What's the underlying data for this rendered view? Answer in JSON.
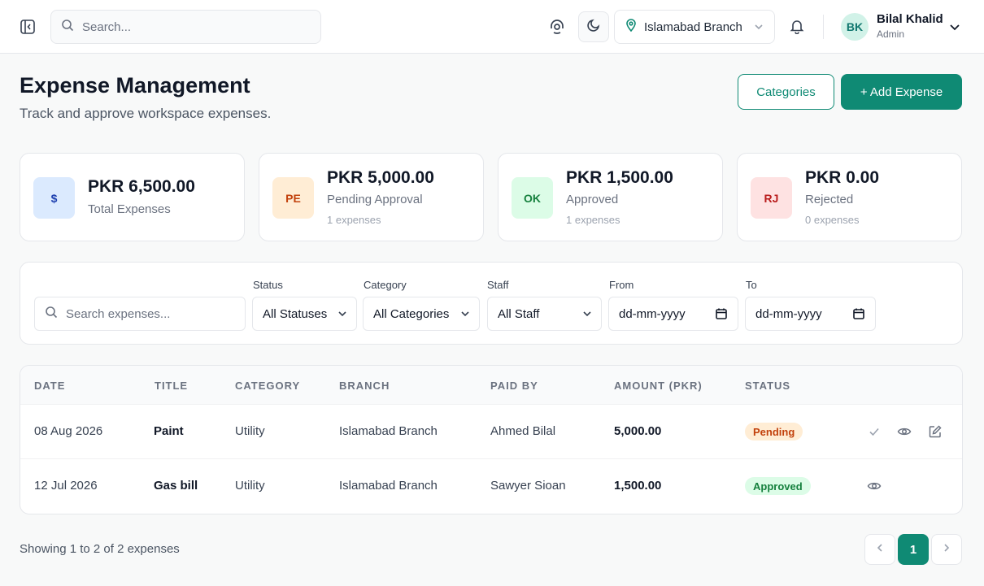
{
  "header": {
    "search_placeholder": "Search...",
    "branch": "Islamabad Branch",
    "user": {
      "initials": "BK",
      "name": "Bilal Khalid",
      "role": "Admin"
    }
  },
  "page": {
    "title": "Expense Management",
    "subtitle": "Track and approve workspace expenses.",
    "categories_label": "Categories",
    "add_label": "+ Add Expense"
  },
  "stats": [
    {
      "icon_text": "$",
      "amount": "PKR 6,500.00",
      "label": "Total Expenses",
      "count": "",
      "icon_bg": "#dbeafe",
      "icon_color": "#1e40af"
    },
    {
      "icon_text": "PE",
      "amount": "PKR 5,000.00",
      "label": "Pending Approval",
      "count": "1 expenses",
      "icon_bg": "#ffedd5",
      "icon_color": "#c2410c"
    },
    {
      "icon_text": "OK",
      "amount": "PKR 1,500.00",
      "label": "Approved",
      "count": "1 expenses",
      "icon_bg": "#dcfce7",
      "icon_color": "#15803d"
    },
    {
      "icon_text": "RJ",
      "amount": "PKR 0.00",
      "label": "Rejected",
      "count": "0 expenses",
      "icon_bg": "#fee2e2",
      "icon_color": "#b91c1c"
    }
  ],
  "filters": {
    "search_placeholder": "Search expenses...",
    "status_label": "Status",
    "status_value": "All Statuses",
    "category_label": "Category",
    "category_value": "All Categories",
    "staff_label": "Staff",
    "staff_value": "All Staff",
    "from_label": "From",
    "from_value": "dd-mm-yyyy",
    "to_label": "To",
    "to_value": "dd-mm-yyyy"
  },
  "table": {
    "columns": [
      "DATE",
      "TITLE",
      "CATEGORY",
      "BRANCH",
      "PAID BY",
      "AMOUNT (PKR)",
      "STATUS"
    ],
    "rows": [
      {
        "date": "08 Aug 2026",
        "title": "Paint",
        "category": "Utility",
        "branch": "Islamabad Branch",
        "paid_by": "Ahmed Bilal",
        "amount": "5,000.00",
        "status": "Pending"
      },
      {
        "date": "12 Jul 2026",
        "title": "Gas bill",
        "category": "Utility",
        "branch": "Islamabad Branch",
        "paid_by": "Sawyer Sioan",
        "amount": "1,500.00",
        "status": "Approved"
      }
    ]
  },
  "footer": {
    "summary": "Showing 1 to 2 of 2 expenses",
    "current_page": "1"
  },
  "colors": {
    "accent": "#0f8a74",
    "pending_bg": "#ffedd5",
    "pending_fg": "#c2410c",
    "approved_bg": "#dcfce7",
    "approved_fg": "#15803d"
  }
}
